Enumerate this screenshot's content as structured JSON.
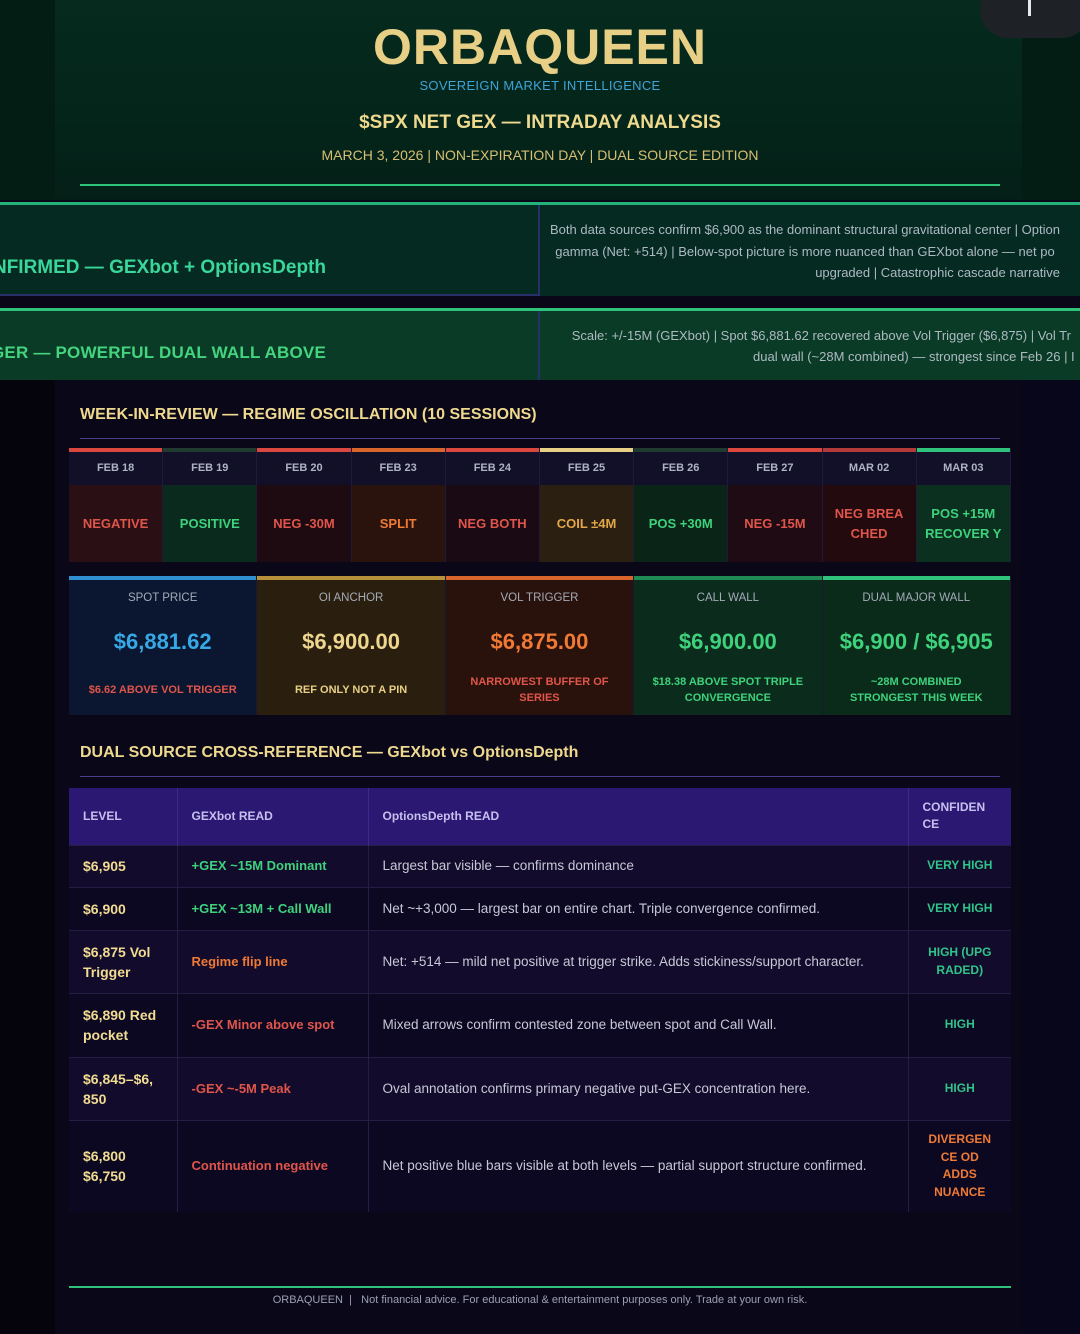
{
  "header": {
    "brand": "ORBAQUEEN",
    "tagline": "SOVEREIGN MARKET INTELLIGENCE",
    "title": "$SPX NET GEX — INTRADAY ANALYSIS",
    "subtitle": "MARCH 3, 2026 | NON-EXPIRATION DAY | DUAL SOURCE EDITION"
  },
  "banners": [
    {
      "label": "NFIRMED — GEXbot + OptionsDepth",
      "text_lines": [
        "Both data sources confirm $6,900 as the dominant structural gravitational center | Option",
        "gamma (Net: +514) | Below-spot picture is more nuanced than GEXbot alone — net po",
        "upgraded | Catastrophic cascade narrative"
      ]
    },
    {
      "label": "VE VOL TRIGGER — POWERFUL DUAL WALL ABOVE",
      "text_lines": [
        "Scale: +/-15M (GEXbot) | Spot $6,881.62 recovered above Vol Trigger ($6,875) | Vol Tr",
        "dual wall (~28M combined) — strongest since Feb 26 | I"
      ]
    }
  ],
  "week_review": {
    "title": "WEEK-IN-REVIEW — REGIME OSCILLATION (10 SESSIONS)",
    "sessions": [
      {
        "date": "FEB 18",
        "state": "NEGATIVE",
        "bar": "#d9473f",
        "bg": "#2a1015",
        "fg": "#e0554a"
      },
      {
        "date": "FEB 19",
        "state": "POSITIVE",
        "bar": "#1f3a2e",
        "bg": "#0b2a1e",
        "fg": "#3ed27c"
      },
      {
        "date": "FEB 20",
        "state": "NEG -30M",
        "bar": "#d9473f",
        "bg": "#1e0b12",
        "fg": "#e0554a"
      },
      {
        "date": "FEB 23",
        "state": "SPLIT",
        "bar": "#d8662c",
        "bg": "#2a130c",
        "fg": "#f07a35"
      },
      {
        "date": "FEB 24",
        "state": "NEG BOTH",
        "bar": "#d9473f",
        "bg": "#1a0a14",
        "fg": "#e0554a"
      },
      {
        "date": "FEB 25",
        "state": "COIL ±4M",
        "bar": "#e8cf86",
        "bg": "#2a1f10",
        "fg": "#e2a74a"
      },
      {
        "date": "FEB 26",
        "state": "POS +30M",
        "bar": "#1f3a2e",
        "bg": "#0a2418",
        "fg": "#3ed27c"
      },
      {
        "date": "FEB 27",
        "state": "NEG -15M",
        "bar": "#d9473f",
        "bg": "#1e0b14",
        "fg": "#e0554a"
      },
      {
        "date": "MAR 02",
        "state": "NEG BREA CHED",
        "bar": "#b23a3a",
        "bg": "#220a0e",
        "fg": "#e0554a"
      },
      {
        "date": "MAR 03",
        "state": "POS +15M RECOVER Y",
        "bar": "#2ec27a",
        "bg": "#0c3020",
        "fg": "#3ed27c"
      }
    ]
  },
  "metrics": [
    {
      "label": "SPOT PRICE",
      "value": "$6,881.62",
      "note": "$6.62 ABOVE VOL TRIGGER",
      "bar": "#2f8fd0",
      "bg": "#0b1630",
      "vcolor": "#37a8e6",
      "ncolor": "#e0554a"
    },
    {
      "label": "OI ANCHOR",
      "value": "$6,900.00",
      "note": "REF ONLY NOT A PIN",
      "bar": "#b7913a",
      "bg": "#2a1f0e",
      "vcolor": "#eed68e",
      "ncolor": "#e8cf86"
    },
    {
      "label": "VOL TRIGGER",
      "value": "$6,875.00",
      "note": "NARROWEST BUFFER OF SERIES",
      "bar": "#d8662c",
      "bg": "#2a120c",
      "vcolor": "#f07a35",
      "ncolor": "#e0554a"
    },
    {
      "label": "CALL WALL",
      "value": "$6,900.00",
      "note": "$18.38 ABOVE SPOT TRIPLE CONVERGENCE",
      "bar": "#1f8a56",
      "bg": "#0b2c1c",
      "vcolor": "#3ed27c",
      "ncolor": "#3ed27c"
    },
    {
      "label": "DUAL MAJOR WALL",
      "value": "$6,900 / $6,905",
      "note": "~28M COMBINED STRONGEST THIS WEEK",
      "bar": "#2ec27a",
      "bg": "#0a2a1a",
      "vcolor": "#3ed27c",
      "ncolor": "#3ed27c"
    }
  ],
  "cross_reference": {
    "title": "DUAL SOURCE CROSS-REFERENCE — GEXbot vs OptionsDepth",
    "headers": [
      "LEVEL",
      "GEXbot READ",
      "OptionsDepth READ",
      "CONFIDEN CE"
    ],
    "rows": [
      {
        "level": "$6,905",
        "gexbot": "+GEX ~15M Dominant",
        "gcolor": "#3ed27c",
        "od": "Largest bar visible — confirms dominance",
        "conf": "VERY HIGH",
        "ccolor": "#2fc48a"
      },
      {
        "level": "$6,900",
        "gexbot": "+GEX ~13M + Call Wall",
        "gcolor": "#3ed27c",
        "od": "Net ~+3,000 — largest bar on entire chart. Triple convergence confirmed.",
        "conf": "VERY HIGH",
        "ccolor": "#2fc48a"
      },
      {
        "level": "$6,875 Vol Trigger",
        "gexbot": "Regime flip line",
        "gcolor": "#f07a35",
        "od": "Net: +514 — mild net positive at trigger strike. Adds stickiness/support character.",
        "conf": "HIGH (UPG RADED)",
        "ccolor": "#2fc48a"
      },
      {
        "level": "$6,890 Red pocket",
        "gexbot": "-GEX Minor above spot",
        "gcolor": "#e0554a",
        "od": "Mixed arrows confirm contested zone between spot and Call Wall.",
        "conf": "HIGH",
        "ccolor": "#2fc48a"
      },
      {
        "level": "$6,845–$6, 850",
        "gexbot": "-GEX ~-5M Peak",
        "gcolor": "#e0554a",
        "od": "Oval annotation confirms primary negative put-GEX concentration here.",
        "conf": "HIGH",
        "ccolor": "#2fc48a"
      },
      {
        "level": "$6,800 $6,750",
        "gexbot": "Continuation negative",
        "gcolor": "#e0554a",
        "od": "Net positive blue bars visible at both levels — partial support structure confirmed.",
        "conf": "DIVERGEN CE OD ADDS NUANCE",
        "ccolor": "#f07a35"
      }
    ]
  },
  "footer": {
    "brand": "ORBAQUEEN",
    "text": "Not financial advice. For educational & entertainment purposes only. Trade at your own risk."
  }
}
